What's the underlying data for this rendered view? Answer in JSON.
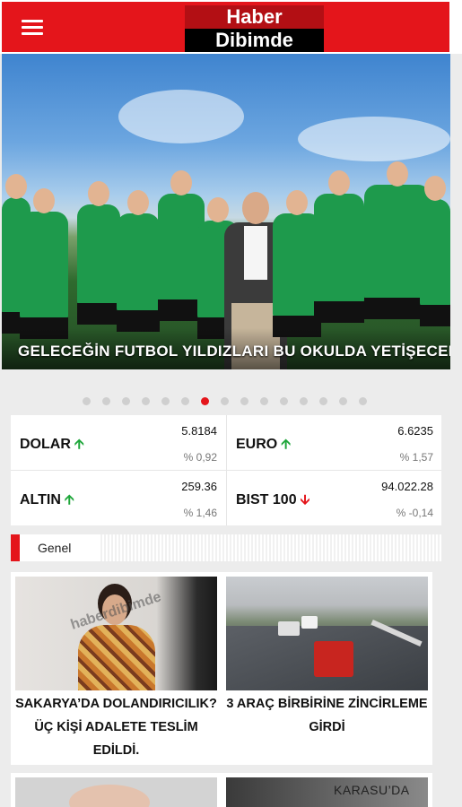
{
  "header": {
    "logo_top": "Haber",
    "logo_bottom": "Dibimde"
  },
  "hero": {
    "title": "GELECEĞİN FUTBOL YILDIZLARI BU OKULDA YETİŞECEK",
    "slides_total": 15,
    "active_slide": 7
  },
  "markets": [
    {
      "name": "DOLAR",
      "value": "5.8184",
      "change": "% 0,92",
      "direction": "up"
    },
    {
      "name": "EURO",
      "value": "6.6235",
      "change": "% 1,57",
      "direction": "up"
    },
    {
      "name": "ALTIN",
      "value": "259.36",
      "change": "% 1,46",
      "direction": "up"
    },
    {
      "name": "BIST 100",
      "value": "94.022.28",
      "change": "% -0,14",
      "direction": "down"
    }
  ],
  "section": {
    "label": "Genel"
  },
  "news": [
    {
      "title": "SAKARYA’DA DOLANDIRICILIK? ÜÇ KİŞİ ADALETE TESLİM EDİLDİ."
    },
    {
      "title": "3 ARAÇ BİRBİRİNE ZİNCİRLEME GİRDİ"
    },
    {
      "title": ""
    },
    {
      "title": "KARASU’DA"
    }
  ],
  "colors": {
    "brand_red": "#e4151b",
    "up": "#1ea63a",
    "down": "#e4151b"
  }
}
